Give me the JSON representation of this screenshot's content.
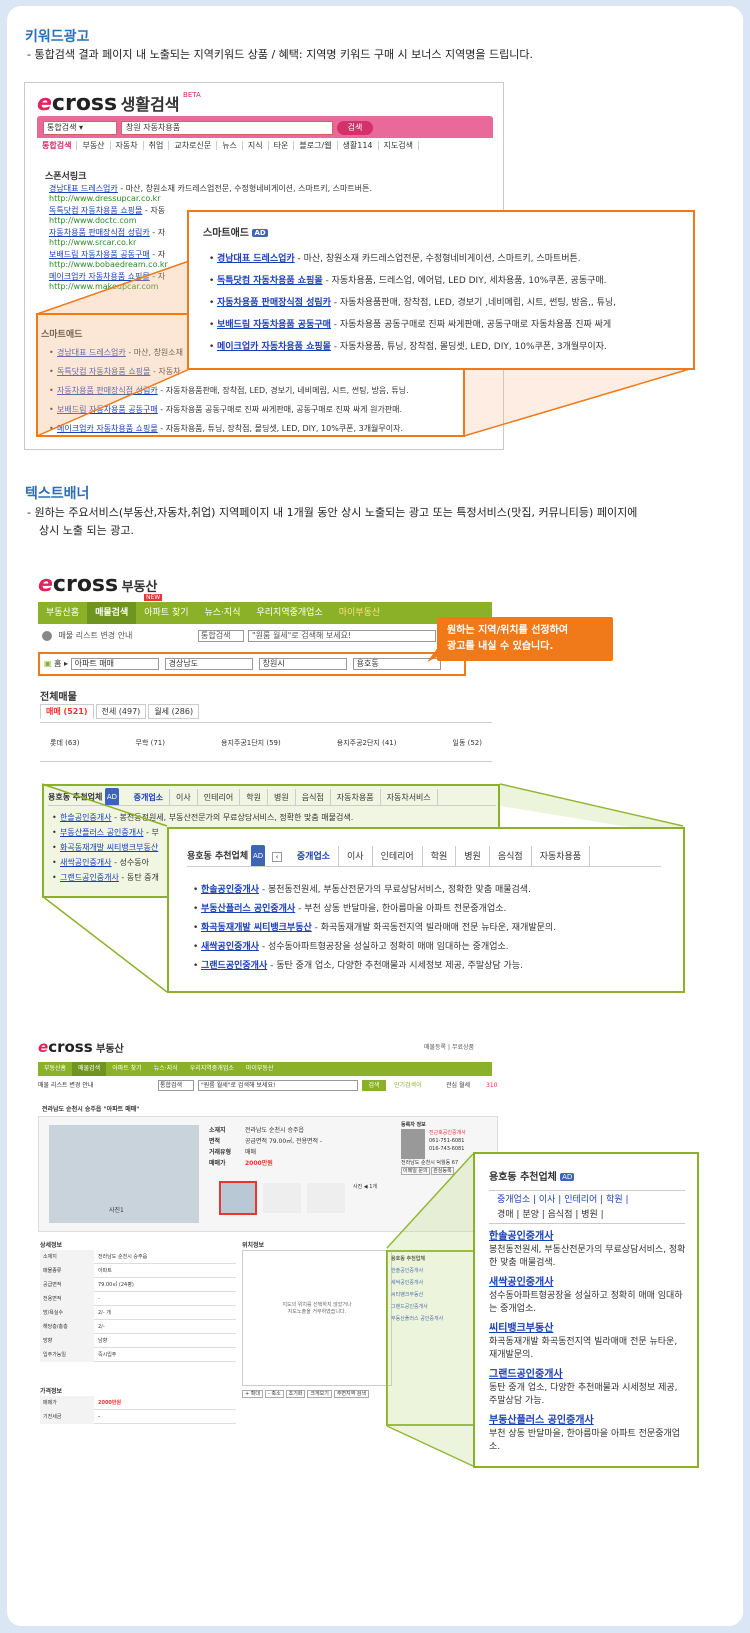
{
  "section1": {
    "title": "키워드광고",
    "desc": "-  통합검색 결과 페이지 내 노출되는 지역키워드 상품   /  혜택:  지역명 키워드 구매 시 보너스 지역명을 드립니다."
  },
  "section2": {
    "title": "텍스트배너",
    "desc_line1": "-  원하는 주요서비스(부동산,자동차,취업) 지역페이지 내 1개월 동안 상시 노출되는 광고 또는 특정서비스(맛집, 커뮤니티등) 페이지에",
    "desc_line2": "상시 노출 되는 광고."
  },
  "shot1": {
    "logo": "cross",
    "logo_sub": "생활검색",
    "beta": "BETA",
    "search_select": "통합검색",
    "search_value": "창원 자동차용품",
    "search_button": "검색",
    "nav": [
      "통합검색",
      "부동산",
      "자동차",
      "취업",
      "교차로신문",
      "뉴스",
      "지식",
      "타운",
      "블로그/웹",
      "생활114",
      "지도검색"
    ],
    "sponsor_title": "스폰서링크",
    "sponsor_links": [
      {
        "title": "경남대표 드레스업카",
        "desc": " - 마산, 창원소재 카드레스업전문, 수정형네비게이션, 스마트키, 스마트버튼.",
        "url": "http://www.dressupcar.co.kr"
      },
      {
        "title": "독특닷컴 자동차용품 쇼핑몰",
        "desc": " - 자동",
        "url": "http://www.doctc.com"
      },
      {
        "title": "자동차용품 판매장식점 성림카",
        "desc": " - 자",
        "url": "http://www.srcar.co.kr"
      },
      {
        "title": "보배드림 자동차용품 공동구매",
        "desc": " - 자",
        "url": "http://www.bobaedream.co.kr"
      },
      {
        "title": "메이크업카 자동차용품 쇼핑몰",
        "desc": " - 자",
        "url": "http://www.makeupcar.com"
      }
    ],
    "smart_title": "스마트애드",
    "smart_links": [
      {
        "title": "경남대표 드레스업카",
        "desc": " - 마산, 창원소재"
      },
      {
        "title": "독특닷컴 자동차용품 쇼핑몰",
        "desc": " - 자동차"
      },
      {
        "title": "자동차용품 판매장식점 성림카",
        "desc": " - 자동차용품판매, 장착점, LED, 경보기, 네비메립, 시트, 썬팅, 방음, 튜닝."
      },
      {
        "title": "보배드림 자동차용품 공동구매",
        "desc": " - 자동차용품 공동구매로 진짜 싸게판매, 공동구매로 진짜 싸게 원가판매."
      },
      {
        "title": "메이크업카 자동차용품 쇼핑몰",
        "desc": " - 자동차용품, 튜닝, 장착점, 몰딩셋, LED, DIY, 10%쿠폰, 3개월무이자."
      }
    ]
  },
  "zoom1": {
    "title": "스마트애드",
    "badge": "AD",
    "items": [
      {
        "title": "경남대표 드레스업카",
        "desc": " - 마산, 창원소재 카드레스업전문, 수정형네비게이션, 스마트키, 스마트버튼."
      },
      {
        "title": "독특닷컴 자동차용품 쇼핑몰",
        "desc": " - 자동차용품, 드레스업, 에어덥, LED DIY, 세차용품, 10%쿠폰, 공동구매."
      },
      {
        "title": "자동차용품 판매장식점 성림카",
        "desc": " - 자동차용품판매, 장착점, LED, 경보기 ,네비메립, 시트, 썬팅, 방음,, 튜닝,"
      },
      {
        "title": "보배드림 자동차용품 공동구매",
        "desc": " - 자동차용품 공동구매로 진짜 싸게판매, 공동구매로 자동차용품 진짜 싸게"
      },
      {
        "title": "메이크업카 자동차용품 쇼핑몰",
        "desc": " - 자동차용품, 튜닝, 장착점, 몰딩셋, LED, DIY, 10%쿠폰, 3개월무이자."
      }
    ]
  },
  "shot2": {
    "logo": "cross",
    "logo_sub": "부동산",
    "nav": [
      "부동산홈",
      "매물검색",
      "아파트 찾기",
      "뉴스·지식",
      "우리지역중개업소",
      "마이부동산"
    ],
    "new_badge": "NEW",
    "recent_label": "매물 리스트 변경 안내",
    "search_select": "통합검색",
    "search_value": "\"원룸 월세\"로 검색해 보세요!",
    "breadcrumb_home": "홈",
    "filters": [
      "아파트 매매",
      "경상남도",
      "창원시",
      "용호동"
    ],
    "callout": "원하는 지역/위치를 선정하여\n광고를 내실 수 있습니다.",
    "all_title": "전체매물",
    "tabs": [
      "매매 (521)",
      "전세 (497)",
      "월세 (286)"
    ],
    "complexes": [
      "롯데 (63)",
      "무학 (71)",
      "용지주공1단지 (59)",
      "용지주공2단지 (41)",
      "일동 (52)"
    ],
    "rec_title": "용호동 추천업체",
    "rec_badge": "AD",
    "rec_tabs": [
      "중개업소",
      "이사",
      "인테리어",
      "학원",
      "병원",
      "음식점",
      "자동차용품",
      "자동차서비스"
    ],
    "rec_items": [
      {
        "title": "한솔공인중개사",
        "desc": " - 봉천동전원세, 부동산전문가의 무료상담서비스, 정확한 맞춤 매물검색."
      },
      {
        "title": "부동산플러스 공인중개사",
        "desc": " - 부"
      },
      {
        "title": "화곡동재개발 씨티뱅크부동산",
        "desc": ""
      },
      {
        "title": "새싹공인중개사",
        "desc": " - 성수동아"
      },
      {
        "title": "그랜드공인중개사",
        "desc": " - 동탄 중개"
      }
    ]
  },
  "zoom2": {
    "title": "용호동 추천업체",
    "badge": "AD",
    "tabs": [
      "중개업소",
      "이사",
      "인테리어",
      "학원",
      "병원",
      "음식점",
      "자동차용품"
    ],
    "items": [
      {
        "title": "한솔공인중개사",
        "desc": " - 봉천동전원세, 부동산전문가의 무료상담서비스, 정확한 맞춤 매물검색."
      },
      {
        "title": "부동산플러스 공인중개사",
        "desc": " - 부천 상동 반달마을, 한아름마을 아파트 전문중개업소."
      },
      {
        "title": "화곡동재개발 씨티뱅크부동산",
        "desc": " - 화곡동재개발 화곡동전지역 빌라매매 전문 뉴타운, 재개발문의."
      },
      {
        "title": "새싹공인중개사",
        "desc": " - 성수동아파트형공장을 성실하고 정확히 매매 임대하는 중개업소."
      },
      {
        "title": "그랜드공인중개사",
        "desc": " - 동탄 중개 업소, 다양한 추천매물과 시세정보 제공, 주말상담 가능."
      }
    ]
  },
  "shot3": {
    "logo": "cross",
    "logo_sub": "부동산",
    "top_links": [
      "매물등록",
      "무료상품"
    ],
    "nav": [
      "부동산홈",
      "매물검색",
      "아파트 찾기",
      "뉴스·지식",
      "우리지역중개업소",
      "마이부동산"
    ],
    "new_badge": "NEW",
    "recent_label": "매물 리스트 변경 안내",
    "search_select": "통합검색",
    "search_value": "\"원룸 월세\"로 검색해 보세요!",
    "search_button": "검색",
    "extra_links": [
      "인기검색어",
      "관심 월세"
    ],
    "extra_count": "310",
    "location": "전라남도 순천시 승주읍 \"아파트 매매\"",
    "info_rows": [
      {
        "k": "소재지",
        "v": "전라남도 순천시 승주읍"
      },
      {
        "k": "면적",
        "v": "공급면적 79.00㎡, 전용면적 -"
      },
      {
        "k": "거래유형",
        "v": "매매"
      },
      {
        "k": "매매가",
        "v": "2000만원"
      }
    ],
    "registrant_title": "등록자 정보",
    "agency_name": "진근호공인중개사",
    "phone1": "061-751-6081",
    "phone2": "016-743-6081",
    "agency_addr": "전라남도 순천시 덕월동 67",
    "btn_profile": "이메일 문의",
    "btn_fav": "관심등록",
    "photo_label": "사진 ◀ 1개",
    "map_label": "사진1",
    "detail_title": "상세정보",
    "detail_rows": [
      {
        "k": "소재지",
        "v": "전라남도 순천시 승주읍"
      },
      {
        "k": "매물종류",
        "v": "아파트"
      },
      {
        "k": "공급면적",
        "v": "79.00㎡ (24평)"
      },
      {
        "k": "전용면적",
        "v": "-"
      },
      {
        "k": "방/욕실수",
        "v": "2/- 개"
      },
      {
        "k": "해당층/총층",
        "v": "2/-"
      },
      {
        "k": "방향",
        "v": "남향"
      },
      {
        "k": "입주가능일",
        "v": "즉시입주"
      }
    ],
    "location_title": "위치정보",
    "map_note": "지도의 위치를 선택하지 않았거나\n지도노출을 거부하였습니다.",
    "map_btns": [
      "+ 확대",
      "- 축소",
      "초기화",
      "크게보기",
      "주변지역 검색"
    ],
    "price_title": "가격정보",
    "price_rows": [
      {
        "k": "매매가",
        "v": "2000만원"
      },
      {
        "k": "기전세금",
        "v": "-"
      }
    ],
    "side_title": "용호동 추천업체",
    "side_items": [
      "한솔공인중개사",
      "새싹공인중개사",
      "씨티뱅크부동산",
      "그랜드공인중개사",
      "부동산플러스 공인중개사"
    ]
  },
  "zoom3": {
    "title": "용호동 추천업체",
    "badge": "AD",
    "tabs_line1": "중개업소 | 이사 | 인테리어 | 학원 |",
    "tabs_line2": "경매 | 분양 | 음식점 | 병원 |",
    "items": [
      {
        "title": "한솔공인중개사",
        "desc": "봉천동전원세, 부동산전문가의 무료상담서비스, 정확한 맞춤 매물검색."
      },
      {
        "title": "새싹공인중개사",
        "desc": "성수동아파트형공장을 성실하고 정확히 매매 임대하는 중개업소."
      },
      {
        "title": "씨티뱅크부동산",
        "desc": "화곡동재개발 화곡동전지역 빌라매매 전문 뉴타운, 재개발문의."
      },
      {
        "title": "그랜드공인중개사",
        "desc": "동탄 중개 업소, 다양한 추천매물과 시세정보 제공, 주말상담 가능."
      },
      {
        "title": "부동산플러스 공인중개사",
        "desc": "부천 상동 반달마을, 한아름마을 아파트 전문중개업소."
      }
    ]
  },
  "colors": {
    "accent": "#2c6fb8",
    "pink": "#e96a9a",
    "green": "#8bb128",
    "orange": "#f07a1a",
    "link": "#1a3fb8"
  }
}
